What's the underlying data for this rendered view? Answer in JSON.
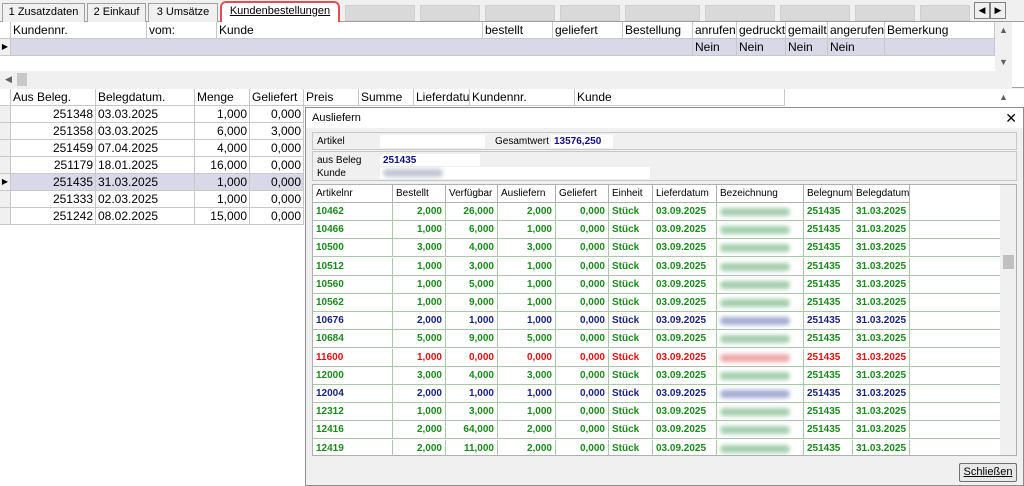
{
  "tabs": [
    {
      "label": "1 Zusatzdaten"
    },
    {
      "label": "2 Einkauf"
    },
    {
      "label": "3 Umsätze"
    },
    {
      "label": "Kundenbestellungen"
    }
  ],
  "orders_grid": {
    "columns": [
      "Kundennr.",
      "vom:",
      "Kunde",
      "bestellt",
      "geliefert",
      "Bestellung",
      "anrufen",
      "gedruckt",
      "gemailt",
      "angerufen",
      "Bemerkung"
    ],
    "row": {
      "anrufen": "Nein",
      "gedruckt": "Nein",
      "gemailt": "Nein",
      "angerufen": "Nein"
    }
  },
  "beleg_grid": {
    "columns": [
      "Aus Beleg.",
      "Belegdatum.",
      "Menge",
      "Geliefert",
      "Preis",
      "Summe",
      "Lieferdatum",
      "Kundennr.",
      "Kunde"
    ],
    "rows": [
      [
        "251348",
        "03.03.2025",
        "1,000",
        "0,000"
      ],
      [
        "251358",
        "03.03.2025",
        "6,000",
        "3,000"
      ],
      [
        "251459",
        "07.04.2025",
        "4,000",
        "0,000"
      ],
      [
        "251179",
        "18.01.2025",
        "16,000",
        "0,000"
      ],
      [
        "251435",
        "31.03.2025",
        "1,000",
        "0,000"
      ],
      [
        "251333",
        "02.03.2025",
        "1,000",
        "0,000"
      ],
      [
        "251242",
        "08.02.2025",
        "15,000",
        "0,000"
      ]
    ],
    "selected_index": 4
  },
  "dialog": {
    "title": "Ausliefern",
    "artikel_label": "Artikel",
    "artikel_value": "",
    "gesamtwert_label": "Gesamtwert",
    "gesamtwert_value": "13576,250",
    "ausbeleg_label": "aus Beleg",
    "ausbeleg_value": "251435",
    "kunde_label": "Kunde",
    "columns": [
      "Artikelnr",
      "Bestellt",
      "Verfügbar",
      "Ausliefern",
      "Geliefert",
      "Einheit",
      "Lieferdatum",
      "Bezeichnung",
      "Belegnummer",
      "Belegdatum"
    ],
    "rows": [
      {
        "artikel": "10462",
        "bestellt": "2,000",
        "verfuegbar": "26,000",
        "ausliefern": "2,000",
        "geliefert": "0,000",
        "einheit": "Stück",
        "lieferdatum": "03.09.2025",
        "beleg": "251435",
        "belegdatum": "31.03.2025",
        "color": "g"
      },
      {
        "artikel": "10466",
        "bestellt": "1,000",
        "verfuegbar": "6,000",
        "ausliefern": "1,000",
        "geliefert": "0,000",
        "einheit": "Stück",
        "lieferdatum": "03.09.2025",
        "beleg": "251435",
        "belegdatum": "31.03.2025",
        "color": "g"
      },
      {
        "artikel": "10500",
        "bestellt": "3,000",
        "verfuegbar": "4,000",
        "ausliefern": "3,000",
        "geliefert": "0,000",
        "einheit": "Stück",
        "lieferdatum": "03.09.2025",
        "beleg": "251435",
        "belegdatum": "31.03.2025",
        "color": "g"
      },
      {
        "artikel": "10512",
        "bestellt": "1,000",
        "verfuegbar": "3,000",
        "ausliefern": "1,000",
        "geliefert": "0,000",
        "einheit": "Stück",
        "lieferdatum": "03.09.2025",
        "beleg": "251435",
        "belegdatum": "31.03.2025",
        "color": "g"
      },
      {
        "artikel": "10560",
        "bestellt": "1,000",
        "verfuegbar": "5,000",
        "ausliefern": "1,000",
        "geliefert": "0,000",
        "einheit": "Stück",
        "lieferdatum": "03.09.2025",
        "beleg": "251435",
        "belegdatum": "31.03.2025",
        "color": "g"
      },
      {
        "artikel": "10562",
        "bestellt": "1,000",
        "verfuegbar": "9,000",
        "ausliefern": "1,000",
        "geliefert": "0,000",
        "einheit": "Stück",
        "lieferdatum": "03.09.2025",
        "beleg": "251435",
        "belegdatum": "31.03.2025",
        "color": "g"
      },
      {
        "artikel": "10676",
        "bestellt": "2,000",
        "verfuegbar": "1,000",
        "ausliefern": "1,000",
        "geliefert": "0,000",
        "einheit": "Stück",
        "lieferdatum": "03.09.2025",
        "beleg": "251435",
        "belegdatum": "31.03.2025",
        "color": "b"
      },
      {
        "artikel": "10684",
        "bestellt": "5,000",
        "verfuegbar": "9,000",
        "ausliefern": "5,000",
        "geliefert": "0,000",
        "einheit": "Stück",
        "lieferdatum": "03.09.2025",
        "beleg": "251435",
        "belegdatum": "31.03.2025",
        "color": "g"
      },
      {
        "artikel": "11600",
        "bestellt": "1,000",
        "verfuegbar": "0,000",
        "ausliefern": "0,000",
        "geliefert": "0,000",
        "einheit": "Stück",
        "lieferdatum": "03.09.2025",
        "beleg": "251435",
        "belegdatum": "31.03.2025",
        "color": "r"
      },
      {
        "artikel": "12000",
        "bestellt": "3,000",
        "verfuegbar": "4,000",
        "ausliefern": "3,000",
        "geliefert": "0,000",
        "einheit": "Stück",
        "lieferdatum": "03.09.2025",
        "beleg": "251435",
        "belegdatum": "31.03.2025",
        "color": "g"
      },
      {
        "artikel": "12004",
        "bestellt": "2,000",
        "verfuegbar": "1,000",
        "ausliefern": "1,000",
        "geliefert": "0,000",
        "einheit": "Stück",
        "lieferdatum": "03.09.2025",
        "beleg": "251435",
        "belegdatum": "31.03.2025",
        "color": "b"
      },
      {
        "artikel": "12312",
        "bestellt": "1,000",
        "verfuegbar": "3,000",
        "ausliefern": "1,000",
        "geliefert": "0,000",
        "einheit": "Stück",
        "lieferdatum": "03.09.2025",
        "beleg": "251435",
        "belegdatum": "31.03.2025",
        "color": "g"
      },
      {
        "artikel": "12416",
        "bestellt": "2,000",
        "verfuegbar": "64,000",
        "ausliefern": "2,000",
        "geliefert": "0,000",
        "einheit": "Stück",
        "lieferdatum": "03.09.2025",
        "beleg": "251435",
        "belegdatum": "31.03.2025",
        "color": "g"
      },
      {
        "artikel": "12419",
        "bestellt": "2,000",
        "verfuegbar": "11,000",
        "ausliefern": "2,000",
        "geliefert": "0,000",
        "einheit": "Stück",
        "lieferdatum": "03.09.2025",
        "beleg": "251435",
        "belegdatum": "31.03.2025",
        "color": "g"
      }
    ],
    "close_button": "Schließen"
  },
  "colors": {
    "green": "#1a8a1a",
    "blue": "#1a237e",
    "red": "#e01010",
    "tab_highlight": "#e05050"
  }
}
